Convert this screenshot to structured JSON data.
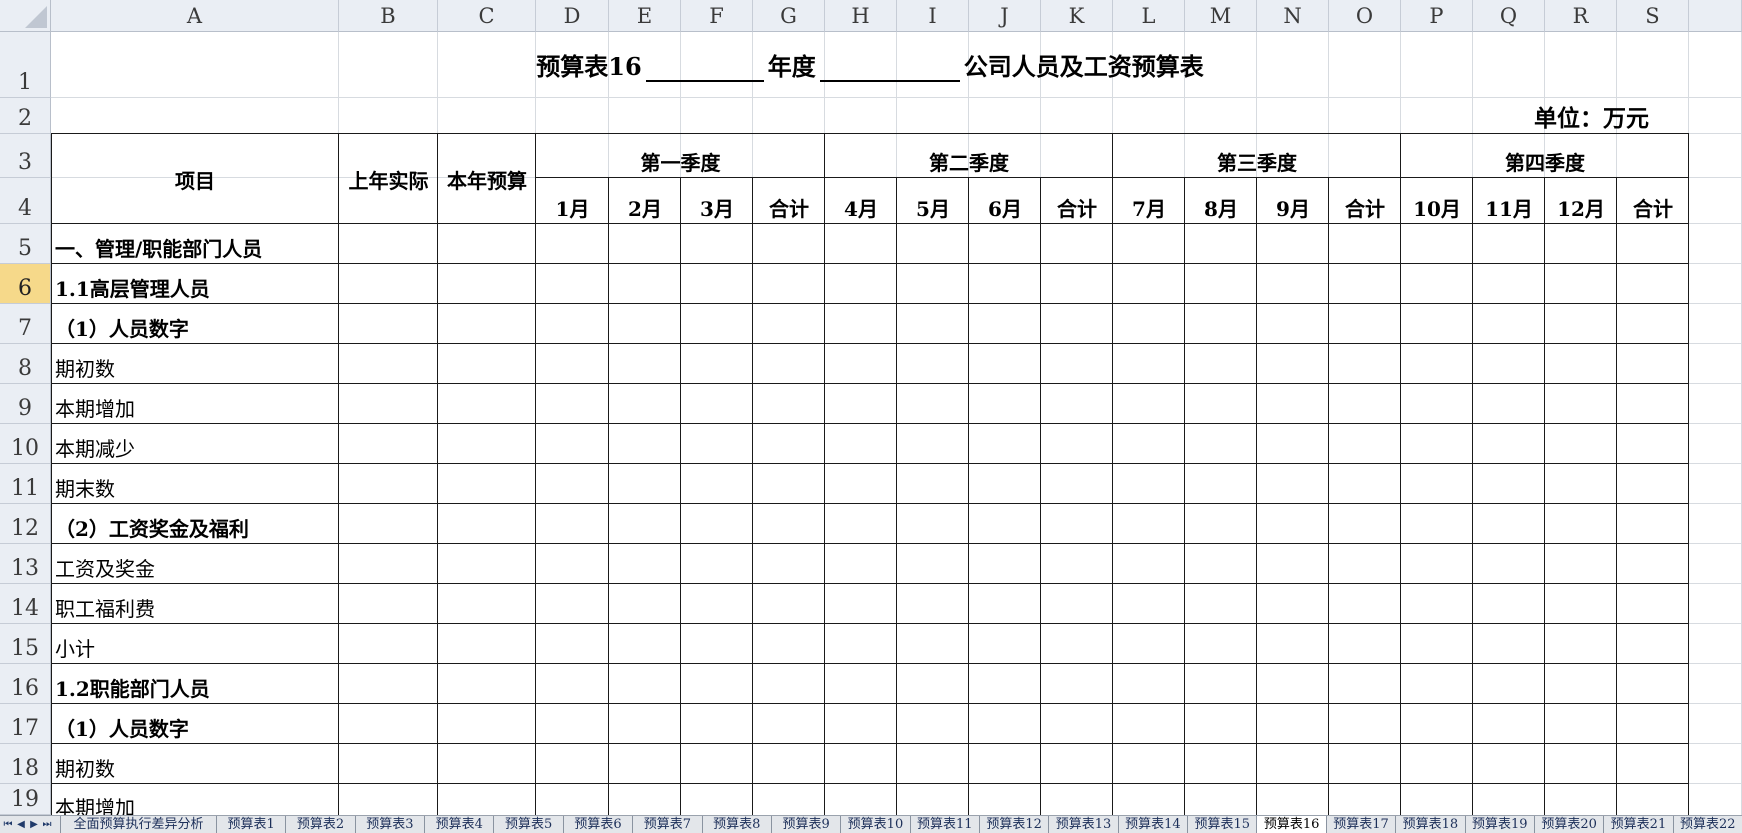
{
  "columns": [
    "A",
    "B",
    "C",
    "D",
    "E",
    "F",
    "G",
    "H",
    "I",
    "J",
    "K",
    "L",
    "M",
    "N",
    "O",
    "P",
    "Q",
    "R",
    "S"
  ],
  "rows": [
    "1",
    "2",
    "3",
    "4",
    "5",
    "6",
    "7",
    "8",
    "9",
    "10",
    "11",
    "12",
    "13",
    "14",
    "15",
    "16",
    "17",
    "18",
    "19"
  ],
  "selected_row": "6",
  "title": {
    "prefix": "预算表16",
    "mid": "年度",
    "suffix": "公司人员及工资预算表"
  },
  "unit": "单位：万元",
  "headers": {
    "item": "项目",
    "last_year_actual": "上年实际",
    "this_year_budget": "本年预算",
    "quarters": [
      "第一季度",
      "第二季度",
      "第三季度",
      "第四季度"
    ],
    "months": [
      "1月",
      "2月",
      "3月",
      "合计",
      "4月",
      "5月",
      "6月",
      "合计",
      "7月",
      "8月",
      "9月",
      "合计",
      "10月",
      "11月",
      "12月",
      "合计"
    ]
  },
  "row_labels": [
    {
      "row": "5",
      "text": "一、管理/职能部门人员",
      "bold": true
    },
    {
      "row": "6",
      "text": "1.1高层管理人员",
      "bold": true
    },
    {
      "row": "7",
      "text": "（1）人员数字",
      "bold": true
    },
    {
      "row": "8",
      "text": "期初数",
      "bold": false
    },
    {
      "row": "9",
      "text": "本期增加",
      "bold": false
    },
    {
      "row": "10",
      "text": "本期减少",
      "bold": false
    },
    {
      "row": "11",
      "text": "期末数",
      "bold": false
    },
    {
      "row": "12",
      "text": "（2）工资奖金及福利",
      "bold": true
    },
    {
      "row": "13",
      "text": "工资及奖金",
      "bold": false
    },
    {
      "row": "14",
      "text": "职工福利费",
      "bold": false
    },
    {
      "row": "15",
      "text": "小计",
      "bold": false
    },
    {
      "row": "16",
      "text": "1.2职能部门人员",
      "bold": true
    },
    {
      "row": "17",
      "text": "（1）人员数字",
      "bold": true
    },
    {
      "row": "18",
      "text": "期初数",
      "bold": false
    },
    {
      "row": "19",
      "text": "本期增加",
      "bold": false
    }
  ],
  "sheet_tabs": [
    "全面预算执行差异分析",
    "预算表1",
    "预算表2",
    "预算表3",
    "预算表4",
    "预算表5",
    "预算表6",
    "预算表7",
    "预算表8",
    "预算表9",
    "预算表10",
    "预算表11",
    "预算表12",
    "预算表13",
    "预算表14",
    "预算表15",
    "预算表16",
    "预算表17",
    "预算表18",
    "预算表19",
    "预算表20",
    "预算表21",
    "预算表22"
  ],
  "active_tab": "预算表16",
  "nav_icons": [
    "first-sheet-icon",
    "prev-sheet-icon",
    "next-sheet-icon",
    "last-sheet-icon"
  ]
}
